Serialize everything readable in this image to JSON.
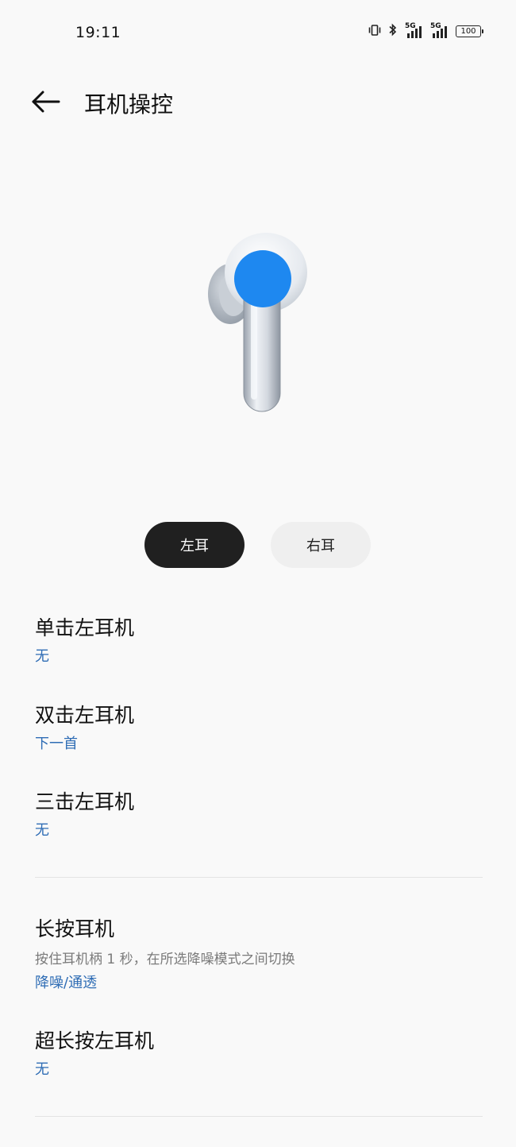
{
  "status_bar": {
    "time": "19:11",
    "network_1": "5G",
    "network_2": "5G",
    "battery": "100",
    "icons": [
      "vibrate-icon",
      "bluetooth-icon",
      "signal-5g-icon",
      "signal-5g-icon",
      "battery-icon"
    ]
  },
  "header": {
    "title": "耳机操控",
    "back_icon": "arrow-left-icon"
  },
  "illustration": {
    "icon": "earbud-illustration",
    "accent": "#1e88f0"
  },
  "tabs": {
    "left": "左耳",
    "right": "右耳",
    "selected": "左耳"
  },
  "settings": {
    "single_tap": {
      "title": "单击左耳机",
      "value": "无"
    },
    "double_tap": {
      "title": "双击左耳机",
      "value": "下一首"
    },
    "triple_tap": {
      "title": "三击左耳机",
      "value": "无"
    },
    "long_press": {
      "title": "长按耳机",
      "desc": "按住耳机柄 1 秒，在所选降噪模式之间切换",
      "value": "降噪/通透"
    },
    "extra_long_press": {
      "title": "超长按左耳机",
      "value": "无"
    }
  },
  "colors": {
    "accent_value": "#2f6db5",
    "selected_tab": "#202020",
    "unselected_tab": "#efefef",
    "background": "#f9f9f9"
  }
}
